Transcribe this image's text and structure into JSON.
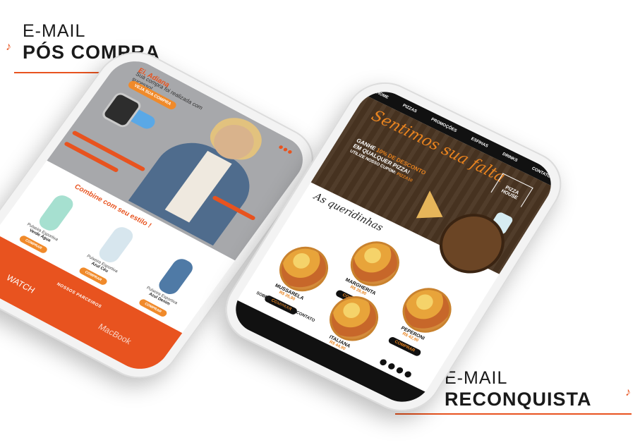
{
  "labels": {
    "top": {
      "line1": "E-MAIL",
      "line2": "PÓS COMPRA"
    },
    "bottom": {
      "line1": "E-MAIL",
      "line2": "RECONQUISTA"
    }
  },
  "email_pos_compra": {
    "greeting": "Ei, Adiana",
    "message": "Sua compra foi realizada com sucesso!",
    "cta": "VEJA SUA COMPRA",
    "tagline": "Combine com seu estilo !",
    "products": [
      {
        "name": "Pulseira Esportiva",
        "color": "Verde Água",
        "button": "COMPRAR",
        "band_color": "#a6e0d0"
      },
      {
        "name": "Pulseira Esportiva",
        "color": "Azul Céu",
        "button": "COMPRAR",
        "band_color": "#d7e6ee"
      },
      {
        "name": "Pulseira Esportiva",
        "color": "Azul Denim",
        "button": "COMPRAR",
        "band_color": "#4f7aa6"
      }
    ],
    "footer": {
      "line": "NOSSOS PARCEIROS",
      "brand1": " WATCH",
      "brand2": " MacBook"
    }
  },
  "email_reconquista": {
    "nav": [
      "HOME",
      "PIZZAS",
      "PROMOÇÕES",
      "ESFIHAS",
      "DRINKS",
      "CONTATO"
    ],
    "headline": "Sentimos sua falta",
    "offer_prefix": "GANHE",
    "offer_value": "10% DE DESCONTO",
    "offer_suffix": "EM QUALQUER PIZZA!",
    "coupon_prefix": "UTILIZE NOSSO CUPOM:",
    "coupon_code": "PIZZA10",
    "brand": "PIZZA HOUSE",
    "favorites": "As queridinhas",
    "pizzas": [
      {
        "name": "MARGHERITA",
        "price": "R$ 39,90",
        "button": "COMPRAR"
      },
      {
        "name": "MUSSARELA",
        "price": "R$ 35,90",
        "button": "COMPRAR"
      },
      {
        "name": "PEPERONI",
        "price": "R$ 42,90",
        "button": "COMPRAR"
      },
      {
        "name": "ITALIANA",
        "price": "R$ 44,90",
        "button": "COMPRAR"
      }
    ],
    "links": [
      "SOBRE",
      "PIZZAS",
      "CONTATO"
    ]
  },
  "colors": {
    "accent": "#e8531f",
    "orange": "#f08a2a",
    "dark": "#111111"
  }
}
